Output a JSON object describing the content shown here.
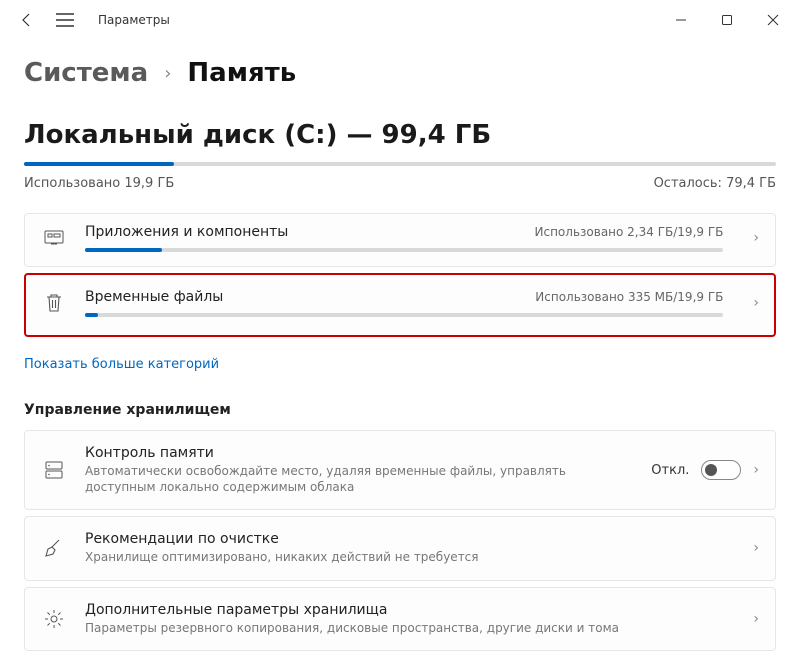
{
  "window": {
    "title": "Параметры"
  },
  "breadcrumb": {
    "crumb1": "Система",
    "crumb2": "Память"
  },
  "disk": {
    "title": "Локальный диск (C:) — 99,4 ГБ",
    "used_pct": 20,
    "used_label": "Использовано 19,9 ГБ",
    "free_label": "Осталось: 79,4 ГБ"
  },
  "categories": [
    {
      "label": "Приложения и компоненты",
      "meta": "Использовано 2,34 ГБ/19,9 ГБ",
      "pct": 12
    },
    {
      "label": "Временные файлы",
      "meta": "Использовано 335 МБ/19,9 ГБ",
      "pct": 2
    }
  ],
  "more_link": "Показать больше категорий",
  "section": {
    "title": "Управление хранилищем"
  },
  "mgmt": [
    {
      "label": "Контроль памяти",
      "desc": "Автоматически освобождайте место, удаляя временные файлы, управлять доступным локально содержимым облака",
      "toggle_label": "Откл.",
      "toggle_on": false
    },
    {
      "label": "Рекомендации по очистке",
      "desc": "Хранилище оптимизировано, никаких действий не требуется"
    },
    {
      "label": "Дополнительные параметры хранилища",
      "desc": "Параметры резервного копирования, дисковые пространства, другие диски и тома"
    }
  ]
}
